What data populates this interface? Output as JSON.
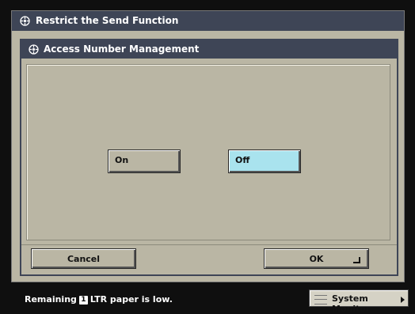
{
  "window": {
    "title": "Restrict the Send Function"
  },
  "dialog": {
    "title": "Access Number Management",
    "on_label": "On",
    "off_label": "Off",
    "selected": "Off"
  },
  "footer": {
    "cancel_label": "Cancel",
    "ok_label": "OK"
  },
  "status": {
    "text_before": "Remaining",
    "tray_number": "1",
    "text_after": "LTR paper is low.",
    "system_monitor_label": "System Monitor"
  },
  "colors": {
    "title_bar": "#3e4556",
    "panel": "#bab6a4",
    "selected_button": "#a9e3ee",
    "background": "#0f0f0f"
  },
  "icons": {
    "title": "function-gear-icon",
    "ok": "enter-mark-icon",
    "system_monitor": "monitor-lines-icon",
    "arrow": "right-arrow-icon"
  }
}
